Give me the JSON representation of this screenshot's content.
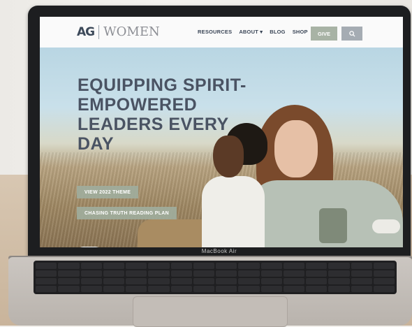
{
  "device": {
    "model_label": "MacBook Air"
  },
  "site": {
    "logo": {
      "ag": "AG",
      "women": "WOMEN"
    },
    "nav": {
      "items": [
        "RESOURCES",
        "ABOUT ▾",
        "BLOG",
        "SHOP"
      ],
      "give_label": "GIVE",
      "search_icon": "search-icon"
    },
    "hero": {
      "headline": [
        "EQUIPPING SPIRIT-",
        "EMPOWERED",
        "LEADERS EVERY",
        "DAY"
      ],
      "buttons": [
        "VIEW 2022 THEME",
        "CHASING TRUTH READING PLAN"
      ]
    }
  },
  "colors": {
    "nav_bg": "#fafafa",
    "headline": "#4a5363",
    "give_button": "#a8b3a5",
    "search_button": "#a5acb3",
    "pill": "#a0ac9c"
  }
}
